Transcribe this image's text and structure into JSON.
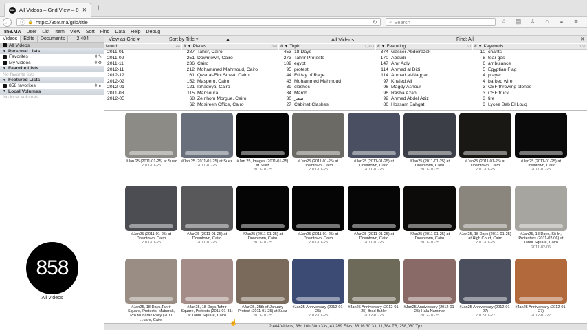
{
  "browser": {
    "tab_title": "All Videos – Grid View – 858.MA",
    "url": "https://858.ma/grid/title",
    "search_placeholder": "Search"
  },
  "menu": {
    "brand": "858.MA",
    "items": [
      "User",
      "List",
      "Item",
      "View",
      "Sort",
      "Find",
      "Data",
      "Help",
      "Debug"
    ]
  },
  "sidebar": {
    "tabs": [
      "Videos",
      "Edits",
      "Documents"
    ],
    "video_count": "2,404",
    "sections": [
      {
        "title": "All Videos",
        "selected": true
      },
      {
        "title": "Personal Lists",
        "header": true
      },
      {
        "title": "Favorites",
        "count": "0"
      },
      {
        "title": "My Videos",
        "count": "0"
      },
      {
        "title": "Favorite Lists",
        "header": true
      },
      {
        "title": "No favorite lists",
        "empty": true
      },
      {
        "title": "Featured Lists",
        "header": true
      },
      {
        "title": "858 favorites",
        "count": "0"
      },
      {
        "title": "Local Volumes",
        "header": true
      },
      {
        "title": "No local volumes",
        "empty": true
      }
    ],
    "logo_text": "858",
    "logo_label": "All Videos"
  },
  "viewbar": {
    "view": "View as Grid",
    "sort": "Sort by Title",
    "title": "All Videos",
    "find": "Find: All"
  },
  "lists": {
    "month": {
      "header": "Month",
      "count": "44",
      "rows": [
        [
          "",
          "2011-01"
        ],
        [
          "",
          "2011-02"
        ],
        [
          "",
          "2011-11"
        ],
        [
          "",
          "2012-11"
        ],
        [
          "",
          "2012-12"
        ],
        [
          "",
          "2012-02"
        ],
        [
          "",
          "2012-01"
        ],
        [
          "",
          "2011-03"
        ],
        [
          "",
          "2012-05"
        ]
      ]
    },
    "places": {
      "header": "Places",
      "count": "248",
      "rows": [
        [
          "287",
          "Tahrir, Cairo"
        ],
        [
          "251",
          "Downtown, Cairo"
        ],
        [
          "236",
          "Cairo"
        ],
        [
          "212",
          "Mohammed Mahmoud, Cairo"
        ],
        [
          "161",
          "Qasr al-Eini Street, Cairo"
        ],
        [
          "152",
          "Maspero, Cairo"
        ],
        [
          "121",
          "Itihadeya, Cairo"
        ],
        [
          "115",
          "Mansoura"
        ],
        [
          "68",
          "Zeinhom Morgue, Cairo"
        ],
        [
          "62",
          "Mosireen Office, Cairo"
        ]
      ]
    },
    "topic": {
      "header": "Topic",
      "count": "1,963",
      "rows": [
        [
          "453",
          "18 Days"
        ],
        [
          "273",
          "Tahrir Protests"
        ],
        [
          "189",
          "egypt"
        ],
        [
          "95",
          "protest"
        ],
        [
          "44",
          "Friday of Rage"
        ],
        [
          "43",
          "Mohammed Mahmoud"
        ],
        [
          "39",
          "clashes"
        ],
        [
          "34",
          "March"
        ],
        [
          "30",
          "مصر"
        ],
        [
          "27",
          "Cabinet Clashes"
        ]
      ]
    },
    "featuring": {
      "header": "Featuring",
      "count": "60",
      "rows": [
        [
          "374",
          "Gasser Abdelrazek"
        ],
        [
          "170",
          "Aboudi"
        ],
        [
          "147",
          "Amr Adly"
        ],
        [
          "114",
          "Ahmed al Didi"
        ],
        [
          "114",
          "Ahmed al-Naggar"
        ],
        [
          "97",
          "Khaled Ali"
        ],
        [
          "96",
          "Magdy Ashour"
        ],
        [
          "96",
          "Rasha Azab"
        ],
        [
          "92",
          "Ahmed Abdel Aziz"
        ],
        [
          "86",
          "Hossam Bahgat"
        ]
      ]
    },
    "keywords": {
      "header": "Keywords",
      "count": "167",
      "rows": [
        [
          "10",
          "chants"
        ],
        [
          "8",
          "tear gas"
        ],
        [
          "6",
          "ambulance"
        ],
        [
          "5",
          "Egyptian Flag"
        ],
        [
          "4",
          "prayer"
        ],
        [
          "4",
          "barbed wire"
        ],
        [
          "3",
          "CSF throwing stones"
        ],
        [
          "3",
          "CSF truck"
        ],
        [
          "3",
          "fire"
        ],
        [
          "3",
          "Lycee Bab El Louq"
        ]
      ]
    }
  },
  "videos": [
    {
      "title": "#Jan 25 (2011-01-25) at Suez",
      "date": "2011-01-25",
      "tone": "#8c8b85"
    },
    {
      "title": "#Jan 25 (2011-01-25) at Suez",
      "date": "2011-01-25",
      "tone": "#6a6f7c"
    },
    {
      "title": "#Jan 25, Images (2011-01-25) at Suez",
      "date": "2011-01-25",
      "tone": "#050505"
    },
    {
      "title": "#Jan25 (2011-01-25) at Downtown, Cairo",
      "date": "2011-01-25",
      "tone": "#6b6a64"
    },
    {
      "title": "#Jan25 (2011-01-25) at Downtown, Cairo",
      "date": "2011-01-25",
      "tone": "#4a5061"
    },
    {
      "title": "#Jan25 (2011-01-25) at Downtown, Cairo",
      "date": "2011-01-25",
      "tone": "#3b3e46"
    },
    {
      "title": "#Jan25 (2011-01-25) at Downtown, Cairo",
      "date": "2011-01-25",
      "tone": "#1a1814"
    },
    {
      "title": "#Jan25 (2011-01-25) at Downtown, Cairo",
      "date": "2011-01-25",
      "tone": "#0a0a0a"
    },
    {
      "title": "#Jan25 (2011-01-25) at Downtown, Cairo",
      "date": "2011-01-25",
      "tone": "#4c4d52"
    },
    {
      "title": "#Jan25 (2011-01-25) at Downtown, Cairo",
      "date": "2011-01-25",
      "tone": "#58585a"
    },
    {
      "title": "#Jan25 (2011-01-25) at Downtown, Cairo",
      "date": "2011-01-25",
      "tone": "#050505"
    },
    {
      "title": "#Jan25 (2011-01-25) at Downtown, Cairo",
      "date": "2011-01-25",
      "tone": "#050505"
    },
    {
      "title": "#Jan25 (2011-01-25) at Downtown, Cairo",
      "date": "2011-01-25",
      "tone": "#060606"
    },
    {
      "title": "#Jan25 (2011-01-25) at Downtown, Cairo",
      "date": "2011-01-25",
      "tone": "#0d0b09"
    },
    {
      "title": "#Jan25, 18 Days (2011-01-25) at High Court, Cairo",
      "date": "2011-01-25",
      "tone": "#8a857d"
    },
    {
      "title": "#Jan25, 18 Days, Sit-In, Protesters (2011-02-06) at Tahrir Square, Cairo",
      "date": "2011-02-06",
      "tone": "#a7a59f"
    },
    {
      "title": "#Jan25, 18 Days,Tahrir Square, Protests, Mubarak, Pro Mubarak Rally (2011 ...uare, Cairo",
      "date": "",
      "tone": "#9a8e84"
    },
    {
      "title": "#Jan25, 18 Days,Tahrir Square, Protests (2011-01-31) at Tahrir Square, Cairo",
      "date": "",
      "tone": "#a48d88"
    },
    {
      "title": "#Jan25, 25th of January Protest (2011-01-25) at Suez",
      "date": "2011-01-25",
      "tone": "#7a6a5c"
    },
    {
      "title": "#Jan25 Anniversary (2012-01-25)",
      "date": "2012-01-25",
      "tone": "#3b4b73"
    },
    {
      "title": "#Jan25 Anniversary (2012-01-25) Brad Butler",
      "date": "2012-01-25",
      "tone": "#6e6a5a"
    },
    {
      "title": "#Jan25 Anniversary (2012-01-25) Hala Nammar",
      "date": "2012-01-25",
      "tone": "#8a6a66"
    },
    {
      "title": "#Jan25 Anniversary (2012-01-27)",
      "date": "2012-01-27",
      "tone": "#4b4f5e"
    },
    {
      "title": "#Jan25 Anniversary (2012-01-27)",
      "date": "2012-01-27",
      "tone": "#b26a3c"
    }
  ],
  "status": "2,404 Videos, 36d 16h 30m 33s, 43,289 Files, 36:16:30:33, 11,384 TB, 258,060 Tpx"
}
